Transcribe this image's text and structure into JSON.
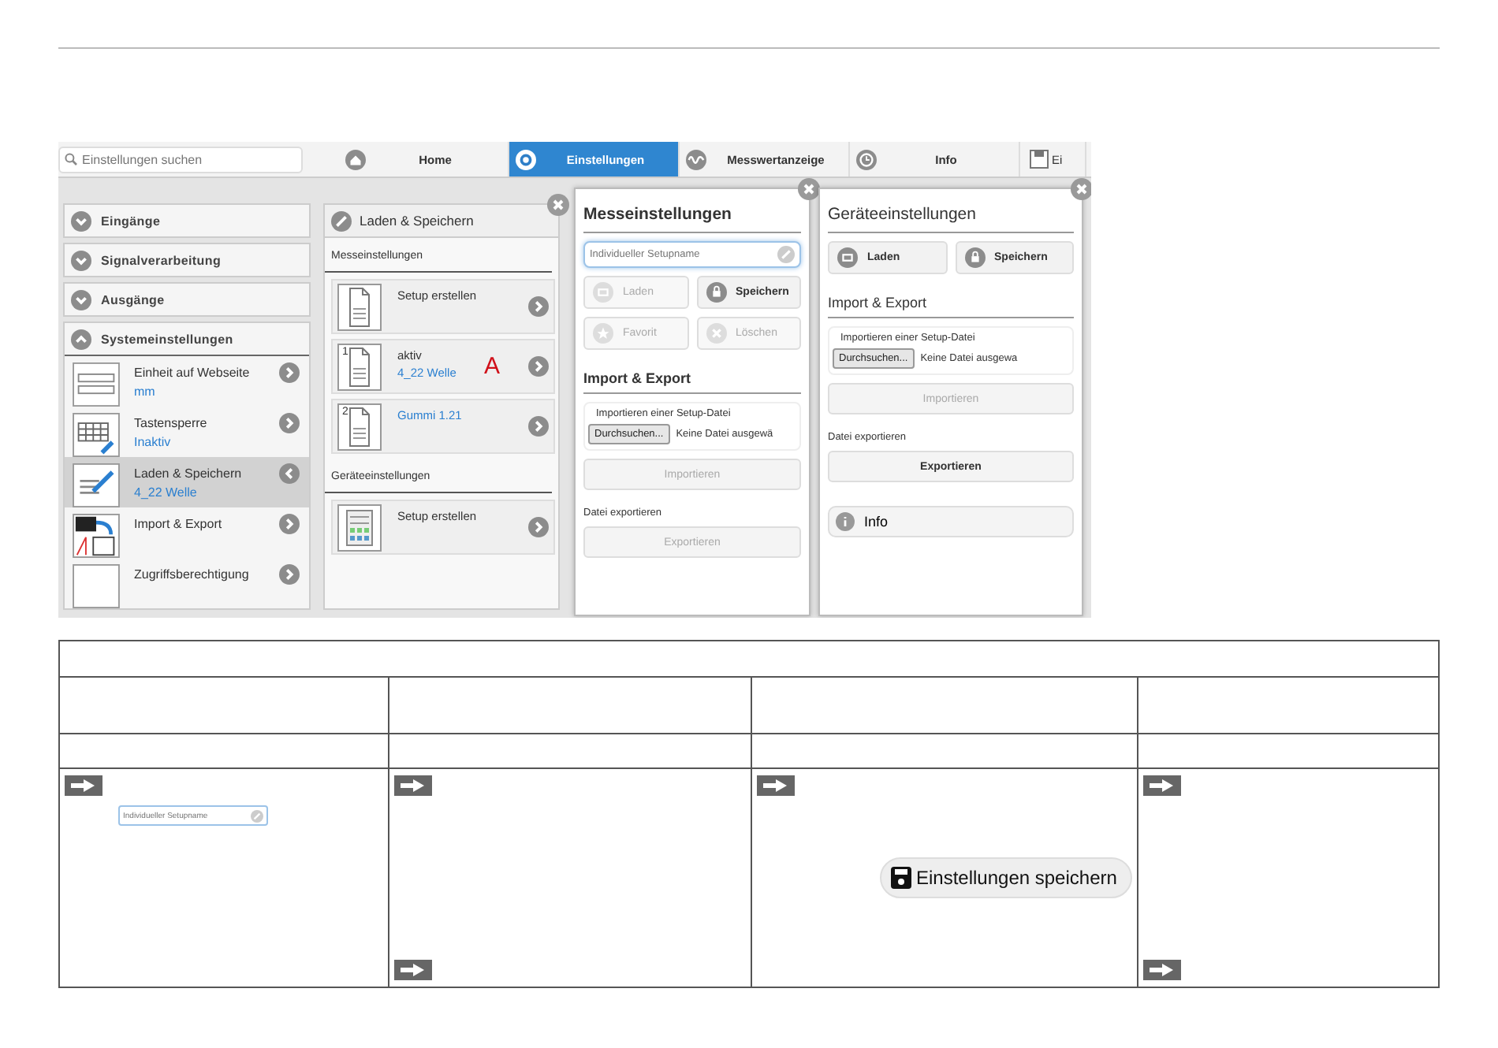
{
  "search": {
    "placeholder": "Einstellungen suchen"
  },
  "tabs": [
    {
      "label": "Home",
      "selected": false
    },
    {
      "label": "Einstellungen",
      "selected": true
    },
    {
      "label": "Messwertanzeige",
      "selected": false
    },
    {
      "label": "Info",
      "selected": false
    },
    {
      "label": "Ei",
      "selected": false
    }
  ],
  "sidebar": {
    "sections": [
      {
        "label": "Eingänge",
        "expanded": false
      },
      {
        "label": "Signalverarbeitung",
        "expanded": false
      },
      {
        "label": "Ausgänge",
        "expanded": false
      },
      {
        "label": "Systemeinstellungen",
        "expanded": true,
        "items": [
          {
            "title": "Einheit auf Webseite",
            "value": "mm",
            "selected": false
          },
          {
            "title": "Tastensperre",
            "value": "Inaktiv",
            "selected": false
          },
          {
            "title": "Laden & Speichern",
            "value": "4_22 Welle",
            "selected": true
          },
          {
            "title": "Import & Export",
            "selected": false
          },
          {
            "title": "Zugriffsberechtigung",
            "selected": false
          }
        ]
      }
    ]
  },
  "load_save_panel": {
    "title": "Laden & Speichern",
    "groups": [
      {
        "title": "Messeinstellungen",
        "cards": [
          {
            "title": "Setup erstellen"
          },
          {
            "icon_label": "1",
            "status": "aktiv",
            "link": "4_22 Welle",
            "marker": "A"
          },
          {
            "icon_label": "2",
            "link": "Gummi 1.21"
          }
        ]
      },
      {
        "title": "Geräteeinstellungen",
        "cards": [
          {
            "title": "Setup erstellen"
          }
        ]
      }
    ]
  },
  "dialogs": [
    {
      "title": "Messeinstellungen",
      "name_field": {
        "placeholder": "Individueller Setupname"
      },
      "buttons": [
        {
          "label": "Laden",
          "disabled": true
        },
        {
          "label": "Speichern",
          "disabled": false
        },
        {
          "label": "Favorit",
          "disabled": true
        },
        {
          "label": "Löschen",
          "disabled": true
        }
      ],
      "section_title": "Import & Export",
      "import_label": "Importieren einer Setup-Datei",
      "browse_button": "Durchsuchen...",
      "file_status": "Keine Datei ausgewä",
      "import_button": {
        "label": "Importieren",
        "disabled": true
      },
      "export_label": "Datei exportieren",
      "export_button": {
        "label": "Exportieren",
        "disabled": true
      }
    },
    {
      "title": "Geräteeinstellungen",
      "buttons": [
        {
          "label": "Laden",
          "disabled": false
        },
        {
          "label": "Speichern",
          "disabled": false
        }
      ],
      "section_title": "Import & Export",
      "import_label": "Importieren einer Setup-Datei",
      "browse_button": "Durchsuchen...",
      "file_status": "Keine Datei ausgewa",
      "import_button": {
        "label": "Importieren",
        "disabled": true
      },
      "export_label": "Datei exportieren",
      "export_button": {
        "label": "Exportieren",
        "disabled": false
      },
      "info_button": "Info"
    }
  ],
  "table": {
    "cells": [
      {
        "items": [
          {
            "kind": "arrow"
          },
          {
            "kind": "field",
            "placeholder": "Individueller Setupname"
          }
        ]
      },
      {
        "items": [
          {
            "kind": "arrow"
          },
          {
            "kind": "arrow"
          }
        ]
      },
      {
        "items": [
          {
            "kind": "arrow"
          },
          {
            "kind": "button",
            "label": "Einstellungen speichern"
          }
        ]
      },
      {
        "items": [
          {
            "kind": "arrow"
          },
          {
            "kind": "arrow"
          }
        ]
      }
    ]
  }
}
